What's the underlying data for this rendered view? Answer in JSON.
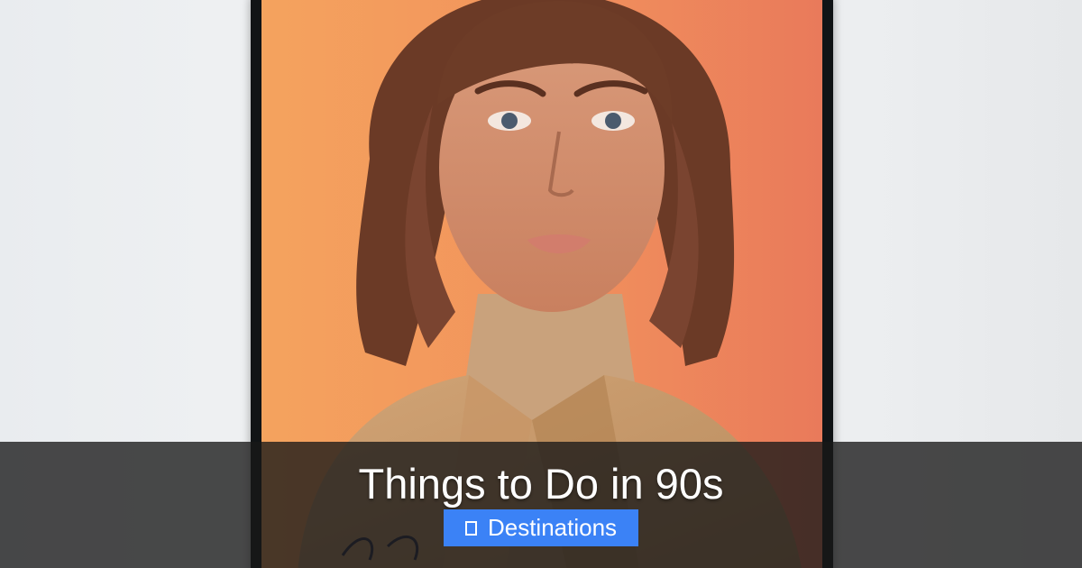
{
  "banner": {
    "title": "Things to Do in 90s",
    "category_label": "Destinations",
    "category_icon": "square-icon",
    "category_color": "#3b82f6"
  },
  "photo": {
    "subject": "framed portrait"
  }
}
